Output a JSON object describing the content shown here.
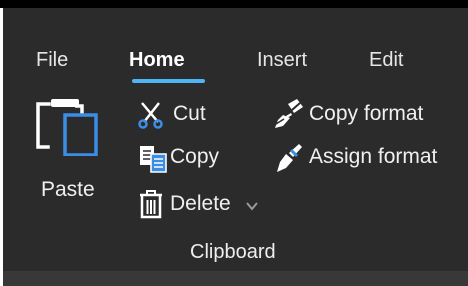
{
  "tabs": [
    "File",
    "Home",
    "Insert",
    "Edit"
  ],
  "active_tab": "Home",
  "clipboard": {
    "paste_label": "Paste",
    "cut_label": "Cut",
    "copy_label": "Copy",
    "delete_label": "Delete",
    "copy_format_label": "Copy format",
    "assign_format_label": "Assign format",
    "group_label": "Clipboard"
  },
  "icons": {
    "paste": "paste-icon",
    "cut": "scissors-icon",
    "copy": "copy-icon",
    "delete": "trash-icon",
    "delete_menu": "chevron-down-icon",
    "copy_format": "format-painter-icon",
    "assign_format": "format-brush-icon"
  },
  "colors": {
    "ribbon_background": "#2b2b2b",
    "active_tab_indicator": "#4fb3f6",
    "accent_icon": "#3a8ee6"
  }
}
